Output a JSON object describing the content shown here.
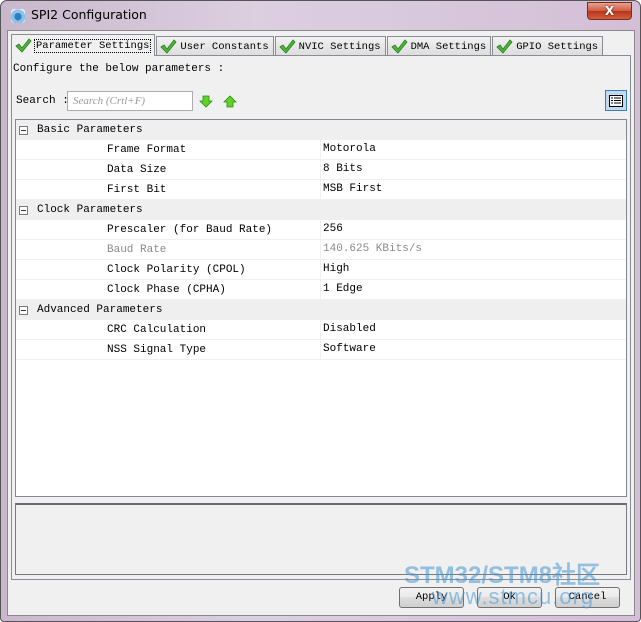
{
  "window": {
    "title": "SPI2 Configuration",
    "close_label": "X"
  },
  "tabs": [
    {
      "label": "Parameter Settings",
      "status": "ok",
      "active": true
    },
    {
      "label": "User Constants",
      "status": "ok",
      "active": false
    },
    {
      "label": "NVIC Settings",
      "status": "ok",
      "active": false
    },
    {
      "label": "DMA Settings",
      "status": "ok",
      "active": false
    },
    {
      "label": "GPIO Settings",
      "status": "ok",
      "active": false
    }
  ],
  "panel": {
    "instruction": "Configure the below parameters :",
    "search_label": "Search :",
    "search_placeholder": "Search (Crtl+F)",
    "search_value": "",
    "icons": {
      "next": "arrow-down-icon",
      "previous": "arrow-up-icon",
      "view_toggle": "list-view-icon"
    }
  },
  "parameters": {
    "categories": [
      {
        "name": "Basic Parameters",
        "expanded": true,
        "items": [
          {
            "name": "Frame Format",
            "value": "Motorola",
            "enabled": true
          },
          {
            "name": "Data Size",
            "value": "8 Bits",
            "enabled": true
          },
          {
            "name": "First Bit",
            "value": "MSB First",
            "enabled": true
          }
        ]
      },
      {
        "name": "Clock Parameters",
        "expanded": true,
        "items": [
          {
            "name": "Prescaler (for Baud Rate)",
            "value": "256",
            "enabled": true
          },
          {
            "name": "Baud Rate",
            "value": "140.625 KBits/s",
            "enabled": false
          },
          {
            "name": "Clock Polarity (CPOL)",
            "value": "High",
            "enabled": true
          },
          {
            "name": "Clock Phase (CPHA)",
            "value": "1 Edge",
            "enabled": true
          }
        ]
      },
      {
        "name": "Advanced Parameters",
        "expanded": true,
        "items": [
          {
            "name": "CRC Calculation",
            "value": "Disabled",
            "enabled": true
          },
          {
            "name": "NSS Signal Type",
            "value": "Software",
            "enabled": true
          }
        ]
      }
    ]
  },
  "buttons": {
    "apply": "Apply",
    "ok": "Ok",
    "cancel": "Cancel"
  },
  "watermark": {
    "line1": "STM32/STM8社区",
    "line2": "www.stmcu.org"
  },
  "colors": {
    "check_green": "#3fae2a",
    "arrow_green": "#4cc21c",
    "toggle_blue": "#c4d9f1",
    "disabled_text": "#8a8a8a"
  }
}
